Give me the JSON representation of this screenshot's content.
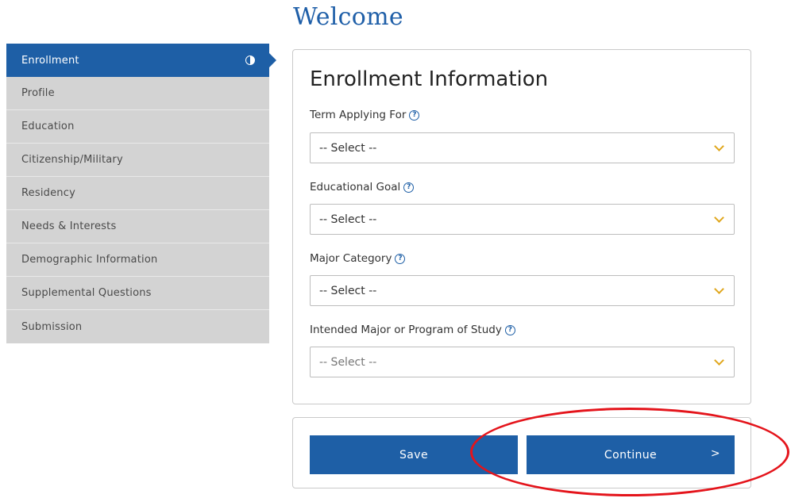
{
  "page": {
    "title": "Welcome"
  },
  "sidebar": {
    "items": [
      {
        "label": "Enrollment",
        "active": true
      },
      {
        "label": "Profile"
      },
      {
        "label": "Education"
      },
      {
        "label": "Citizenship/Military"
      },
      {
        "label": "Residency"
      },
      {
        "label": "Needs & Interests"
      },
      {
        "label": "Demographic Information"
      },
      {
        "label": "Supplemental Questions"
      },
      {
        "label": "Submission"
      }
    ]
  },
  "form": {
    "title": "Enrollment Information",
    "fields": [
      {
        "label": "Term Applying For",
        "value": "-- Select --"
      },
      {
        "label": "Educational Goal",
        "value": "-- Select --"
      },
      {
        "label": "Major Category",
        "value": "-- Select --"
      },
      {
        "label": "Intended Major or Program of Study",
        "value": "-- Select --",
        "disabled": true
      }
    ],
    "help_glyph": "?"
  },
  "actions": {
    "save_label": "Save",
    "continue_label": "Continue",
    "continue_arrow": ">"
  },
  "colors": {
    "primary": "#1e5fa6",
    "sidebar_bg": "#d3d3d3",
    "chevron": "#e0a71d",
    "annotation": "#e4141b"
  },
  "icons": {
    "progress": "half-filled-circle-icon",
    "help": "question-circle-icon",
    "dropdown": "chevron-down-icon"
  }
}
